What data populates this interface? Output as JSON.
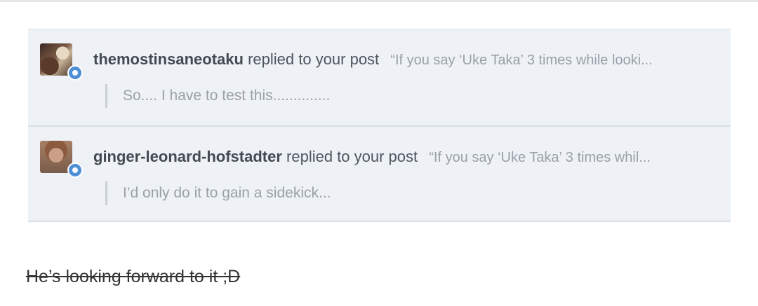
{
  "notifications": [
    {
      "username": "themostinsaneotaku",
      "action": "replied to your post",
      "post_quote": "“If you say ‘Uke Taka’ 3 times while looki...",
      "reply": "So.... I have to test this..............",
      "avatar_icon": "user-avatar",
      "badge_icon": "reply-bubble-icon",
      "badge_color": "#4e8fd6"
    },
    {
      "username": "ginger-leonard-hofstadter",
      "action": "replied to your post",
      "post_quote": "“If you say ‘Uke Taka’ 3 times whil...",
      "reply": "I’d only do it to gain a sidekick...",
      "avatar_icon": "user-avatar",
      "badge_icon": "reply-bubble-icon",
      "badge_color": "#4e8fd6"
    }
  ],
  "caption": "He’s looking forward to it ;D",
  "colors": {
    "panel_background": "#eef2f7",
    "divider": "#d9dfe7",
    "username_text": "#444a52",
    "muted_text": "#9aa0a7"
  }
}
